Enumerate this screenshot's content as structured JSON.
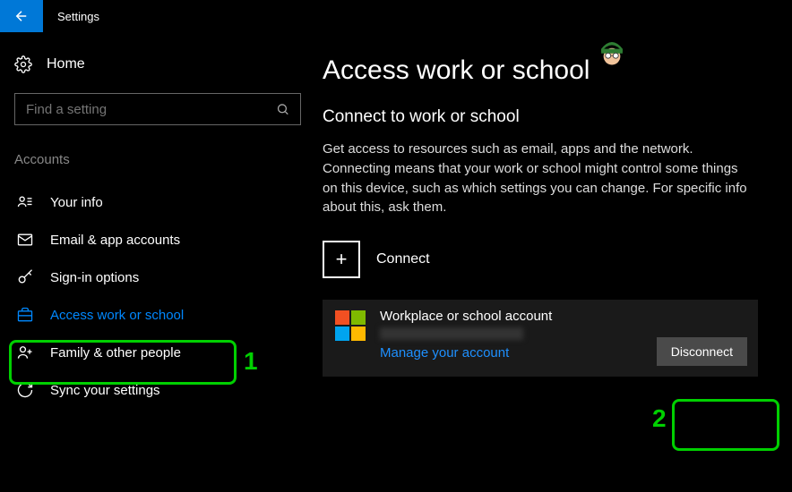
{
  "topbar": {
    "title": "Settings"
  },
  "sidebar": {
    "home_label": "Home",
    "search_placeholder": "Find a setting",
    "section_header": "Accounts",
    "items": [
      {
        "label": "Your info"
      },
      {
        "label": "Email & app accounts"
      },
      {
        "label": "Sign-in options"
      },
      {
        "label": "Access work or school"
      },
      {
        "label": "Family & other people"
      },
      {
        "label": "Sync your settings"
      }
    ]
  },
  "main": {
    "title": "Access work or school",
    "subtitle": "Connect to work or school",
    "description": "Get access to resources such as email, apps and the network. Connecting means that your work or school might control some things on this device, such as which settings you can change. For specific info about this, ask them.",
    "connect_label": "Connect",
    "account": {
      "title": "Workplace or school account",
      "manage_link": "Manage your account",
      "disconnect_label": "Disconnect"
    }
  },
  "annotations": {
    "callout1": "1",
    "callout2": "2"
  }
}
